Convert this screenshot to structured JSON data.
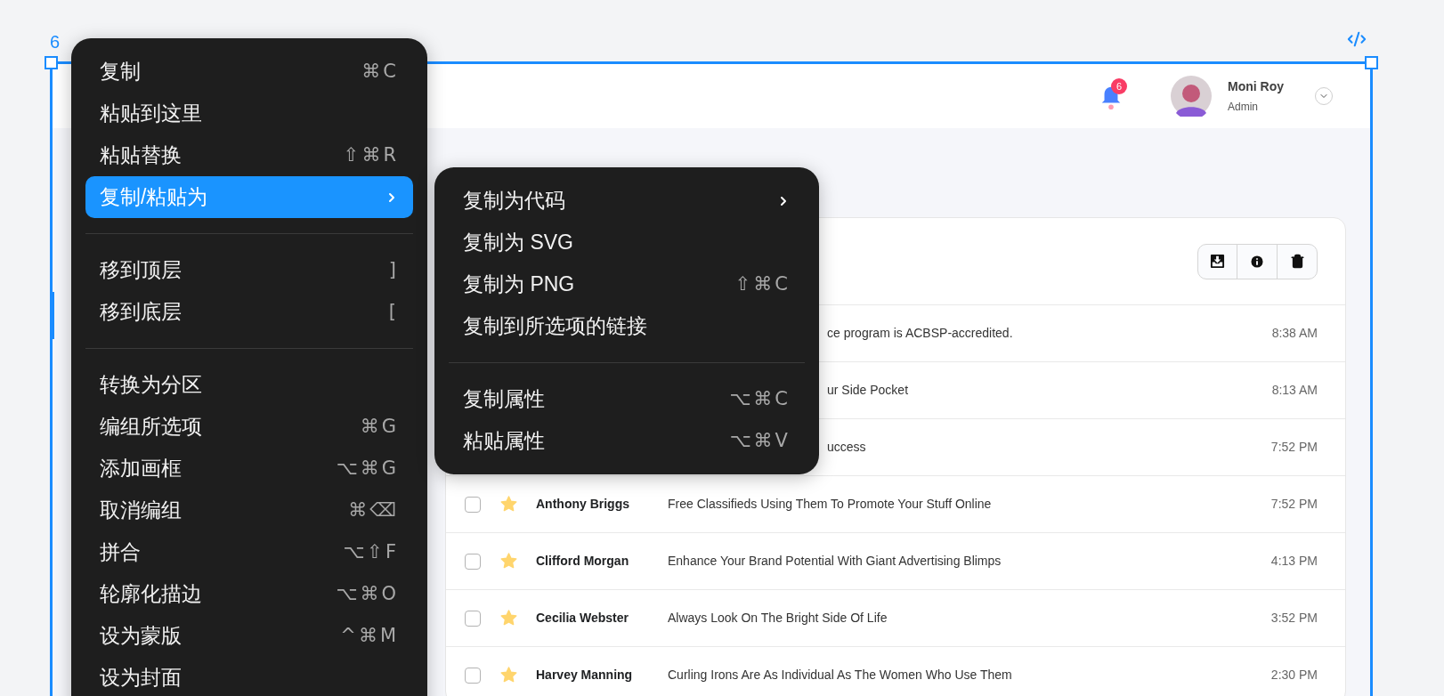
{
  "canvas": {
    "frame_label": "6"
  },
  "header": {
    "notifications": {
      "count": "6"
    },
    "user": {
      "name": "Moni Roy",
      "role": "Admin"
    }
  },
  "rows": [
    {
      "covered": true,
      "subject": "ce program is ACBSP-accredited.",
      "time": "8:38 AM"
    },
    {
      "covered": true,
      "subject": "ur Side Pocket",
      "time": "8:13 AM"
    },
    {
      "covered": true,
      "subject": "uccess",
      "time": "7:52 PM"
    },
    {
      "covered": false,
      "starred": true,
      "checked": false,
      "sender": "Anthony Briggs",
      "subject": "Free Classifieds Using Them To Promote Your Stuff Online",
      "time": "7:52 PM"
    },
    {
      "covered": false,
      "starred": true,
      "checked": false,
      "sender": "Clifford Morgan",
      "subject": "Enhance Your Brand Potential With Giant Advertising Blimps",
      "time": "4:13 PM"
    },
    {
      "covered": false,
      "starred": true,
      "checked": false,
      "sender": "Cecilia Webster",
      "subject": "Always Look On The Bright Side Of Life",
      "time": "3:52 PM"
    },
    {
      "covered": false,
      "starred": true,
      "checked": false,
      "sender": "Harvey Manning",
      "subject": "Curling Irons Are As Individual As The Women Who Use Them",
      "time": "2:30 PM"
    }
  ],
  "context_menu": {
    "groups": [
      [
        {
          "label": "复制",
          "shortcut": "⌘C",
          "selected": false,
          "submenu": false
        },
        {
          "label": "粘贴到这里",
          "selected": false,
          "submenu": false
        },
        {
          "label": "粘贴替换",
          "shortcut": "⇧⌘R",
          "selected": false,
          "submenu": false
        },
        {
          "label": "复制/粘贴为",
          "selected": true,
          "submenu": true
        }
      ],
      [
        {
          "label": "移到顶层",
          "shortcut": "]",
          "selected": false,
          "submenu": false
        },
        {
          "label": "移到底层",
          "shortcut": "[",
          "selected": false,
          "submenu": false
        }
      ],
      [
        {
          "label": "转换为分区",
          "selected": false,
          "submenu": false
        },
        {
          "label": "编组所选项",
          "shortcut": "⌘G",
          "selected": false,
          "submenu": false
        },
        {
          "label": "添加画框",
          "shortcut": "⌥⌘G",
          "selected": false,
          "submenu": false
        },
        {
          "label": "取消编组",
          "shortcut": "⌘⌫",
          "selected": false,
          "submenu": false
        },
        {
          "label": "拼合",
          "shortcut": "⌥⇧F",
          "selected": false,
          "submenu": false
        },
        {
          "label": "轮廓化描边",
          "shortcut": "⌥⌘O",
          "selected": false,
          "submenu": false
        },
        {
          "label": "设为蒙版",
          "shortcut": "^⌘M",
          "selected": false,
          "submenu": false
        },
        {
          "label": "设为封面",
          "selected": false,
          "submenu": false
        }
      ]
    ]
  },
  "submenu": {
    "groups": [
      [
        {
          "label": "复制为代码",
          "selected": false,
          "submenu": true
        },
        {
          "label": "复制为 SVG",
          "selected": false,
          "submenu": false
        },
        {
          "label": "复制为 PNG",
          "shortcut": "⇧⌘C",
          "selected": false,
          "submenu": false
        },
        {
          "label": "复制到所选项的链接",
          "selected": false,
          "submenu": false
        }
      ],
      [
        {
          "label": "复制属性",
          "shortcut": "⌥⌘C",
          "selected": false,
          "submenu": false
        },
        {
          "label": "粘贴属性",
          "shortcut": "⌥⌘V",
          "selected": false,
          "submenu": false
        }
      ]
    ]
  }
}
